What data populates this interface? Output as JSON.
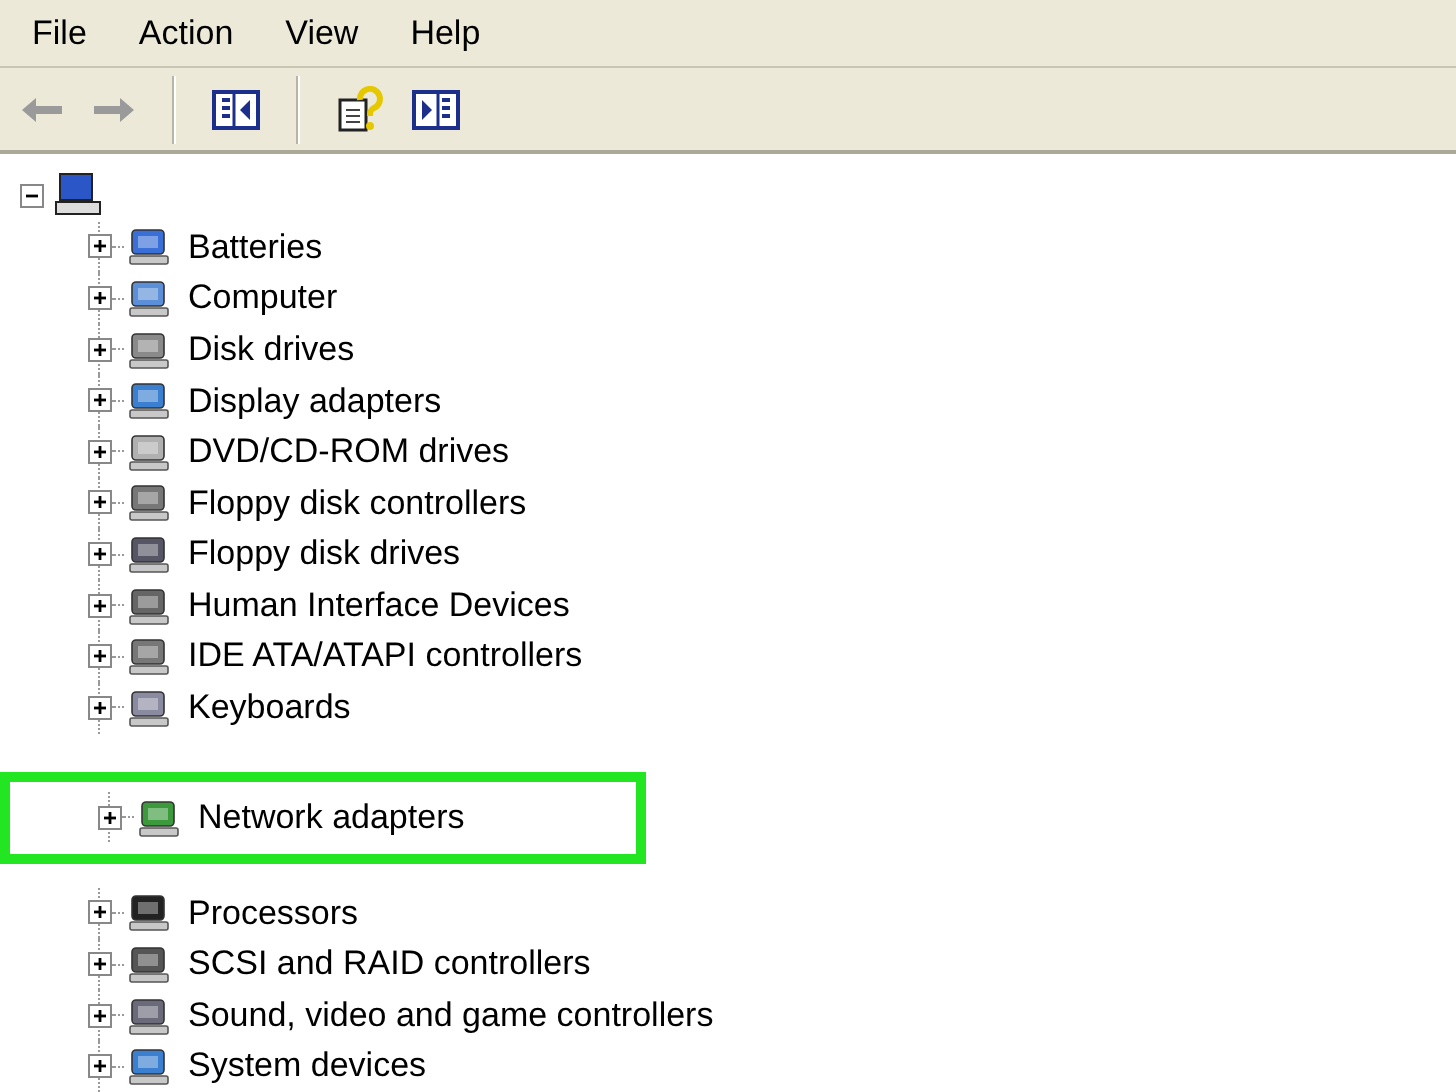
{
  "menu": [
    "File",
    "Action",
    "View",
    "Help"
  ],
  "toolbar": [
    {
      "kind": "back",
      "disabled": true
    },
    {
      "kind": "forward",
      "disabled": true
    },
    {
      "kind": "sep"
    },
    {
      "kind": "pane"
    },
    {
      "kind": "sep"
    },
    {
      "kind": "help"
    },
    {
      "kind": "panel"
    }
  ],
  "tree": {
    "expanded": true,
    "children": [
      {
        "label": "Batteries",
        "expanded": false,
        "highlighted": false
      },
      {
        "label": "Computer",
        "expanded": false,
        "highlighted": false
      },
      {
        "label": "Disk drives",
        "expanded": false,
        "highlighted": false
      },
      {
        "label": "Display adapters",
        "expanded": false,
        "highlighted": false
      },
      {
        "label": "DVD/CD-ROM drives",
        "expanded": false,
        "highlighted": false
      },
      {
        "label": "Floppy disk controllers",
        "expanded": false,
        "highlighted": false
      },
      {
        "label": "Floppy disk drives",
        "expanded": false,
        "highlighted": false
      },
      {
        "label": "Human Interface Devices",
        "expanded": false,
        "highlighted": false
      },
      {
        "label": "IDE ATA/ATAPI controllers",
        "expanded": false,
        "highlighted": false
      },
      {
        "label": "Keyboards",
        "expanded": false,
        "highlighted": false
      },
      {
        "label": "Network adapters",
        "expanded": false,
        "highlighted": true
      },
      {
        "label": "Processors",
        "expanded": false,
        "highlighted": false
      },
      {
        "label": "SCSI and RAID controllers",
        "expanded": false,
        "highlighted": false
      },
      {
        "label": "Sound, video and game controllers",
        "expanded": false,
        "highlighted": false
      },
      {
        "label": "System devices",
        "expanded": false,
        "highlighted": false
      }
    ]
  }
}
